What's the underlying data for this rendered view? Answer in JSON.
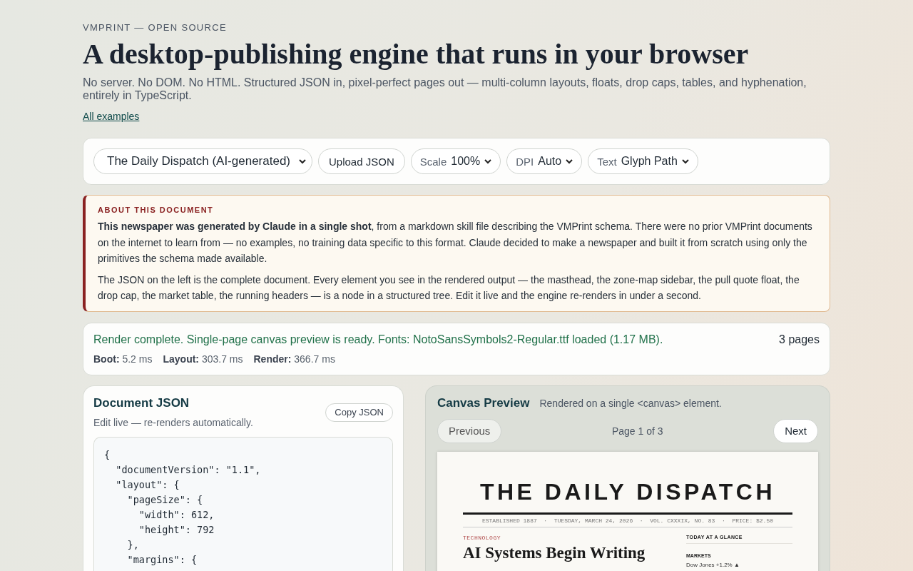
{
  "header": {
    "eyebrow": "VMPRINT — OPEN SOURCE",
    "title": "A desktop-publishing engine that runs in your browser",
    "subtitle": "No server. No DOM. No HTML. Structured JSON in, pixel-perfect pages out — multi-column layouts, floats, drop caps, tables, and hyphenation, entirely in TypeScript.",
    "link": "All examples"
  },
  "toolbar": {
    "document_select": "The Daily Dispatch (AI-generated)",
    "upload_button": "Upload JSON",
    "selects": [
      {
        "label": "Scale",
        "value": "100%"
      },
      {
        "label": "DPI",
        "value": "Auto"
      },
      {
        "label": "Text",
        "value": "Glyph Path"
      }
    ]
  },
  "about": {
    "heading": "ABOUT THIS DOCUMENT",
    "paragraphs": [
      "**This newspaper was generated by Claude in a single shot**, from a markdown skill file describing the VMPrint schema. There were no prior VMPrint documents on the internet to learn from — no examples, no training data specific to this format. Claude decided to make a newspaper and built it from scratch using only the primitives the schema made available.",
      "The JSON on the left is the complete document. Every element you see in the rendered output — the masthead, the zone-map sidebar, the pull quote float, the drop cap, the market table, the running headers — is a node in a structured tree. Edit it live and the engine re-renders in under a second."
    ]
  },
  "status": {
    "message": "Render complete. Single-page canvas preview is ready. Fonts: NotoSansSymbols2-Regular.ttf loaded (1.17 MB).",
    "page_count": "3 pages",
    "timings": [
      {
        "label": "Boot:",
        "value": "5.2 ms"
      },
      {
        "label": "Layout:",
        "value": "303.7 ms"
      },
      {
        "label": "Render:",
        "value": "366.7 ms"
      }
    ]
  },
  "editor": {
    "title": "Document JSON",
    "hint": "Edit live — re-renders automatically.",
    "copy_button": "Copy JSON",
    "code_lines": [
      "{",
      "  \"documentVersion\": \"1.1\",",
      "  \"layout\": {",
      "    \"pageSize\": {",
      "      \"width\": 612,",
      "      \"height\": 792",
      "    },",
      "    \"margins\": {"
    ]
  },
  "preview": {
    "title": "Canvas Preview",
    "caption": "Rendered on a single <canvas> element.",
    "previous_button": "Previous",
    "page_indicator": "Page 1 of 3",
    "next_button": "Next",
    "page": {
      "masthead": "THE DAILY DISPATCH",
      "dateline": "ESTABLISHED 1887  ·  TUESDAY, MARCH 24, 2026  ·  VOL. CXXXIX, NO. 83  ·  PRICE: $2.50",
      "section": "TECHNOLOGY",
      "headline": "AI Systems Begin Writing",
      "sidebar_title": "TODAY AT A GLANCE",
      "sidebar_section": "MARKETS",
      "sidebar_line": "Dow Jones +1.2% ▲"
    }
  }
}
